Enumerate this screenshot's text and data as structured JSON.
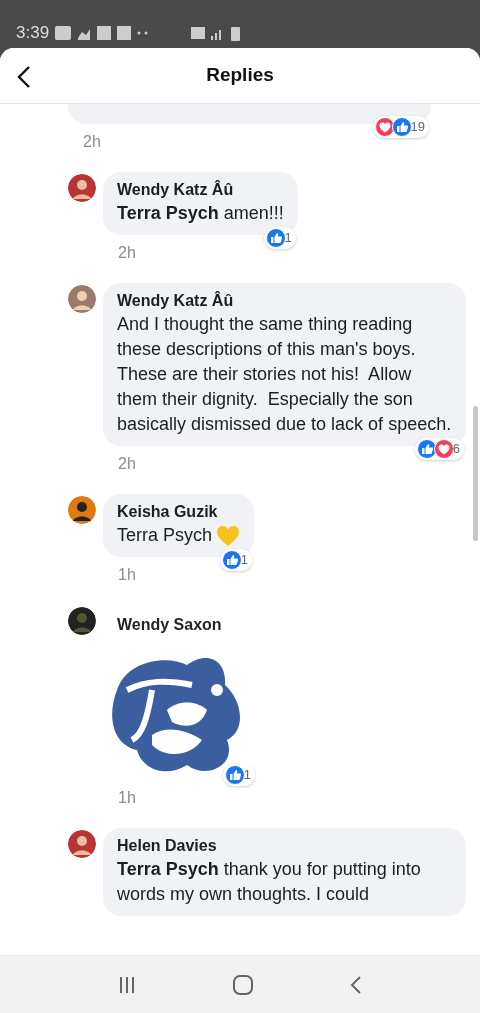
{
  "status_bar": {
    "time": "3:39"
  },
  "header": {
    "title": "Replies"
  },
  "comments": [
    {
      "kind": "partial",
      "time": "2h",
      "reactions": [
        {
          "kind": "love"
        },
        {
          "kind": "like"
        }
      ],
      "reaction_count": "19"
    },
    {
      "kind": "text",
      "author": "Wendy Katz Âû",
      "text": "**Terra Psych** amen!!!",
      "time": "2h",
      "reactions": [
        {
          "kind": "like"
        }
      ],
      "reaction_count": "1"
    },
    {
      "kind": "text",
      "author": "Wendy Katz Âû",
      "text": "And I thought the same thing reading these descriptions of this man's boys.  These are their stories not his!  Allow them their dignity.  Especially the son basically dismissed due to lack of speech.",
      "time": "2h",
      "reactions": [
        {
          "kind": "like"
        },
        {
          "kind": "love"
        }
      ],
      "reaction_count": "6"
    },
    {
      "kind": "text",
      "author": "Keisha Guzik",
      "text": "Terra Psych",
      "heart_emoji": true,
      "time": "1h",
      "reactions": [
        {
          "kind": "like"
        }
      ],
      "reaction_count": "1"
    },
    {
      "kind": "sticker",
      "author": "Wendy Saxon",
      "time": "1h",
      "reactions": [
        {
          "kind": "like"
        }
      ],
      "reaction_count": "1"
    },
    {
      "kind": "text",
      "author": "Helen Davies",
      "text": "**Terra Psych** thank you for putting into words my own thoughts. I could"
    }
  ]
}
